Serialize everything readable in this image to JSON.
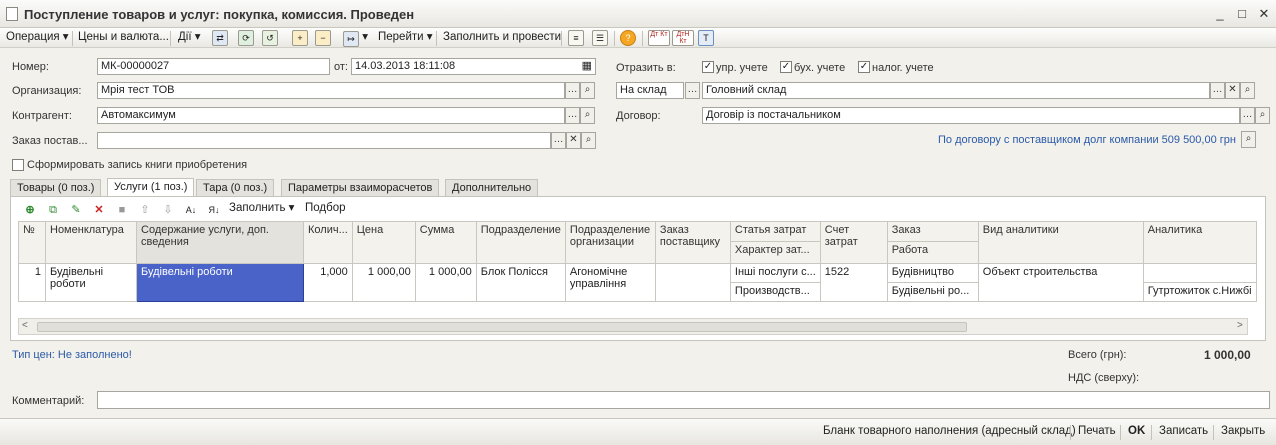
{
  "window": {
    "title": "Поступление товаров и услуг: покупка, комиссия. Проведен",
    "minimize": "_",
    "maximize": "□",
    "close": "✕"
  },
  "toolbar": {
    "operation": "Операция",
    "prices": "Цены и валюта...",
    "actions": "Дії",
    "goto": "Перейти",
    "fill_post": "Заполнить и провести",
    "dt_kt": "Дт Кт",
    "dtn_kt": "ДтН Кт"
  },
  "form": {
    "number_label": "Номер:",
    "number": "МК-00000027",
    "from_label": "от:",
    "date": "14.03.2013 18:11:08",
    "org_label": "Организация:",
    "org": "Мрія тест ТОВ",
    "contractor_label": "Контрагент:",
    "contractor": "Автомаксимум",
    "order_label": "Заказ постав...",
    "order": "",
    "reflect_label": "Отразить в:",
    "chk_mgmt": "упр. учете",
    "chk_acc": "бух. учете",
    "chk_tax": "налог. учете",
    "warehouse_type": "На склад",
    "warehouse": "Головний склад",
    "contract_label": "Договор:",
    "contract": "Договір із постачальником",
    "debt_info": "По договору с поставщиком долг компании 509 500,00 грн",
    "purchase_book": "Сформировать запись книги приобретения"
  },
  "tabs": [
    "Товары (0 поз.)",
    "Услуги (1 поз.)",
    "Тара (0 поз.)",
    "Параметры взаиморасчетов",
    "Дополнительно"
  ],
  "grid_toolbar": {
    "fill": "Заполнить",
    "select": "Подбор"
  },
  "grid": {
    "headers": {
      "n": "№",
      "nomen": "Номенклатура",
      "content": "Содержание услуги, доп. сведения",
      "qty": "Колич...",
      "price": "Цена",
      "sum": "Сумма",
      "dept": "Подразделение",
      "org_dept": "Подразделение организации",
      "supplier_order": "Заказ поставщику",
      "cost_item": "Статья затрат",
      "cost_nature": "Характер зат...",
      "cost_account": "Счет затрат",
      "order": "Заказ",
      "work": "Работа",
      "analytics_type": "Вид аналитики",
      "analytics": "Аналитика"
    },
    "row": {
      "n": "1",
      "nomen": "Будівельні роботи",
      "content": "Будівельні роботи",
      "qty": "1,000",
      "price": "1 000,00",
      "sum": "1 000,00",
      "dept": "Блок Полісся",
      "org_dept": "Агономічне управління",
      "supplier_order": "",
      "cost_item": "Інші послуги с...",
      "cost_nature": "Производств...",
      "cost_account": "1522",
      "order": "Будівництво",
      "work": "Будівельні ро...",
      "analytics_type": "Объект строительства",
      "analytics": "Гутртожиток с.Нижбі"
    }
  },
  "footer": {
    "price_type": "Тип цен: Не заполнено!",
    "total_label": "Всего (грн):",
    "total": "1 000,00",
    "vat_label": "НДС (сверху):",
    "comment_label": "Комментарий:",
    "comment": ""
  },
  "bottom": {
    "blank": "Бланк товарного наполнения (адресный склад)",
    "print": "Печать",
    "ok": "OK",
    "save": "Записать",
    "close": "Закрыть"
  }
}
